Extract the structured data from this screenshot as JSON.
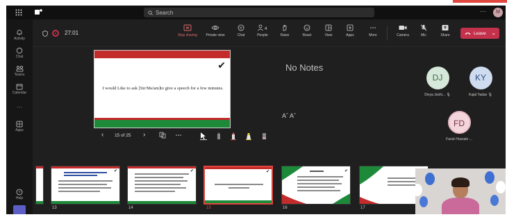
{
  "titlebar": {
    "search_label": "Search",
    "more_label": "···",
    "avatar_initial": "M"
  },
  "rail": {
    "items": [
      {
        "label": "Activity",
        "icon": "bell-icon"
      },
      {
        "label": "Chat",
        "icon": "chat-icon"
      },
      {
        "label": "Teams",
        "icon": "teams-icon"
      },
      {
        "label": "Calendar",
        "icon": "calendar-icon"
      },
      {
        "label": "···",
        "icon": "more-icon"
      },
      {
        "label": "Apps",
        "icon": "apps-icon"
      },
      {
        "label": "Help",
        "icon": "help-icon"
      }
    ]
  },
  "meeting": {
    "timer": "27:01",
    "toolbar": [
      {
        "label": "Stop sharing",
        "icon": "stop-sharing-icon"
      },
      {
        "label": "Private view",
        "icon": "eye-icon"
      },
      {
        "label": "Chat",
        "icon": "chat-icon"
      },
      {
        "label": "People",
        "icon": "people-icon",
        "count": "4"
      },
      {
        "label": "Raise",
        "icon": "hand-icon"
      },
      {
        "label": "React",
        "icon": "smiley-icon"
      },
      {
        "label": "View",
        "icon": "view-icon"
      },
      {
        "label": "Apps",
        "icon": "apps-plus-icon"
      },
      {
        "label": "More",
        "icon": "more-icon"
      },
      {
        "label": "Camera",
        "icon": "camera-icon"
      },
      {
        "label": "Mic",
        "icon": "mic-off-icon"
      },
      {
        "label": "Share",
        "icon": "share-icon"
      }
    ],
    "leave_label": "Leave"
  },
  "slide": {
    "text": "I would Like to ask  [Sir/Ma'am]to give a speech for a few minutes.",
    "page_label": "15 of 25"
  },
  "notes": {
    "empty_label": "No Notes",
    "font_size_label": "Aˆ Aˇ"
  },
  "participants": [
    {
      "initials": "DJ",
      "name": "Divya Joshi...",
      "color": "#d6e8d9",
      "text_color": "#3d6b46"
    },
    {
      "initials": "KY",
      "name": "Kajal Yadav",
      "color": "#cfdcf0",
      "text_color": "#2f4f7f"
    },
    {
      "initials": "FD",
      "name": "Faruk Hussain ...",
      "color": "#f3d6dc",
      "text_color": "#7a2f3f"
    }
  ],
  "thumbnails": [
    {
      "num": "13"
    },
    {
      "num": "14"
    },
    {
      "num": "15",
      "selected": true
    },
    {
      "num": "16"
    },
    {
      "num": "17"
    }
  ],
  "colors": {
    "accent_red": "#c4314b",
    "slide_red": "#c42b2b",
    "slide_green": "#1d8a3a"
  }
}
